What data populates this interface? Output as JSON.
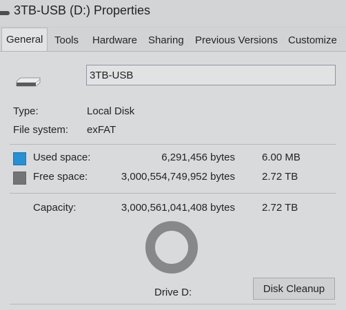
{
  "window": {
    "title": "3TB-USB (D:) Properties",
    "title_icon": "drive-icon"
  },
  "tabs": [
    {
      "label": "General",
      "active": true
    },
    {
      "label": "Tools"
    },
    {
      "label": "Hardware"
    },
    {
      "label": "Sharing"
    },
    {
      "label": "Previous Versions"
    },
    {
      "label": "Customize"
    }
  ],
  "general": {
    "drive_icon": "usb-drive-icon",
    "volume_name": "3TB-USB",
    "type_label": "Type:",
    "type_value": "Local Disk",
    "fs_label": "File system:",
    "fs_value": "exFAT",
    "used": {
      "label": "Used space:",
      "bytes": "6,291,456 bytes",
      "size": "6.00 MB",
      "color": "#2490d6"
    },
    "free": {
      "label": "Free space:",
      "bytes": "3,000,554,749,952 bytes",
      "size": "2.72 TB",
      "color": "#737476"
    },
    "capacity": {
      "label": "Capacity:",
      "bytes": "3,000,561,041,408 bytes",
      "size": "2.72 TB"
    },
    "drive_label": "Drive D:",
    "cleanup_button": "Disk Cleanup"
  }
}
